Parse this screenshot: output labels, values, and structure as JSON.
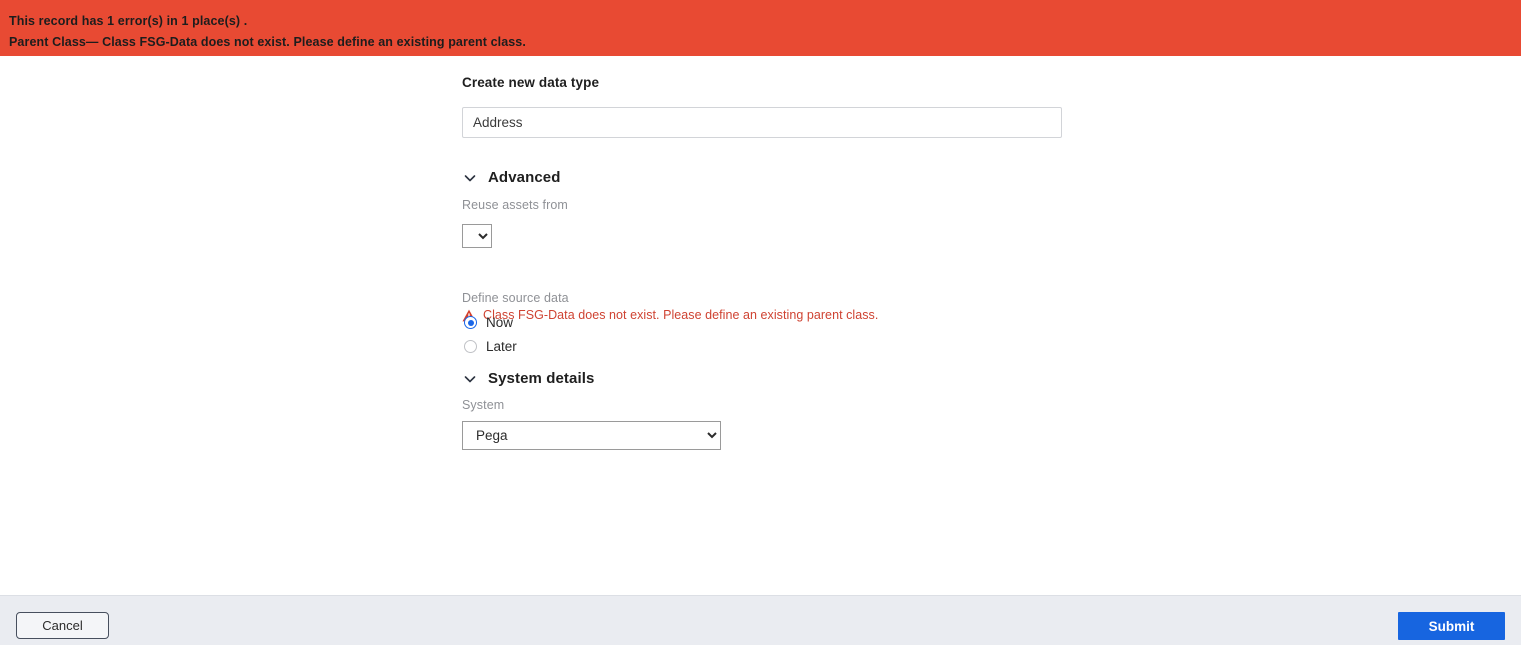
{
  "banner": {
    "line1": "This record has 1 error(s) in 1 place(s) .",
    "line2": "Parent Class— Class FSG-Data does not exist. Please define an existing parent class.",
    "background_color": "#e84a33",
    "text_color": "#1d1d1d"
  },
  "form": {
    "title": "Create new data type",
    "name_field": {
      "value": "Address",
      "placeholder": "Address"
    },
    "advanced": {
      "header": "Advanced",
      "expanded": true,
      "reuse_assets": {
        "label": "Reuse assets from",
        "value": "",
        "options": [
          ""
        ]
      },
      "inline_error": {
        "icon": "warning-triangle-icon",
        "text": "Class FSG-Data does not exist. Please define an existing parent class.",
        "color": "#cf4332"
      },
      "define_source_data": {
        "label": "Define source data",
        "selected": "Now",
        "options": [
          {
            "label": "Now",
            "checked": true
          },
          {
            "label": "Later",
            "checked": false
          }
        ]
      }
    },
    "system_details": {
      "header": "System details",
      "expanded": true,
      "system": {
        "label": "System",
        "value": "Pega",
        "options": [
          "Pega"
        ]
      }
    }
  },
  "footer": {
    "cancel_label": "Cancel",
    "submit_label": "Submit",
    "submit_color": "#1765e0",
    "background_color": "#eaecf1"
  }
}
